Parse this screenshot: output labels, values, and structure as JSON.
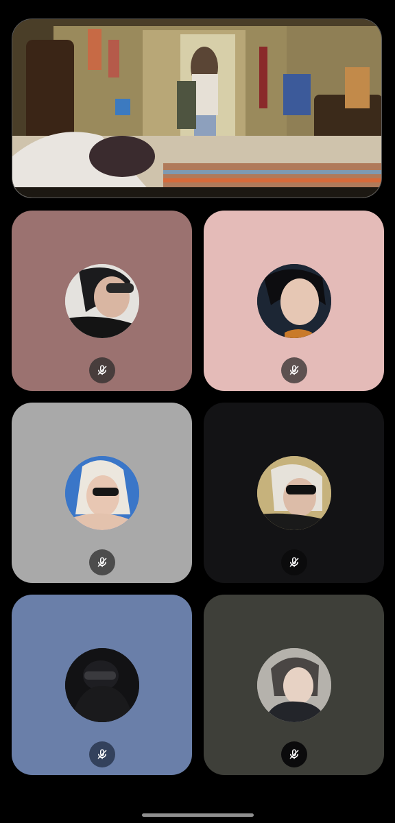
{
  "screen": {
    "video_feed": {
      "icon": "video-stream"
    },
    "participants": [
      {
        "tile_color": "#9b7270",
        "muted": true,
        "icon": "mic-off-icon"
      },
      {
        "tile_color": "#e4bbb8",
        "muted": true,
        "icon": "mic-off-icon"
      },
      {
        "tile_color": "#a9a9a9",
        "muted": true,
        "icon": "mic-off-icon"
      },
      {
        "tile_color": "#131315",
        "muted": true,
        "icon": "mic-off-icon"
      },
      {
        "tile_color": "#6a7fa9",
        "muted": true,
        "icon": "mic-off-icon"
      },
      {
        "tile_color": "#3e3f39",
        "muted": true,
        "icon": "mic-off-icon"
      }
    ]
  }
}
